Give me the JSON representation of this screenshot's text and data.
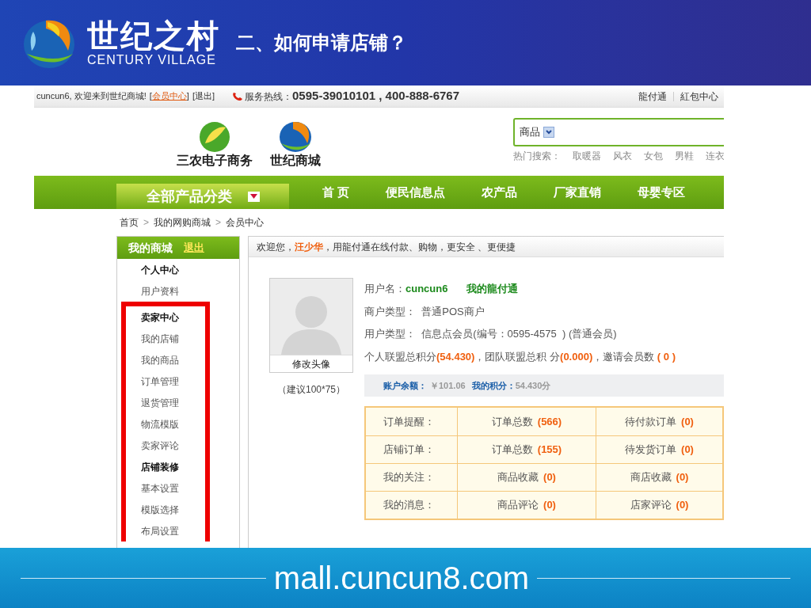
{
  "slide": {
    "brand_cn": "世纪之村",
    "brand_en": "CENTURY VILLAGE",
    "title": "二、如何申请店铺？",
    "footer_url": "mall.cuncun8.com"
  },
  "top_bar": {
    "greeting": "cuncun6, 欢迎来到世纪商城!",
    "member_link_brackets": [
      "[",
      "]"
    ],
    "member_link": "会员中心",
    "logout_link": "[退出]",
    "hotline_label": "服务热线：",
    "hotline_numbers": "0595-39010101 , 400-888-6767",
    "links": [
      "龍付通",
      "紅包中心"
    ]
  },
  "logos": [
    {
      "label": "三农电子商务"
    },
    {
      "label": "世纪商城"
    }
  ],
  "search": {
    "category": "商品",
    "hot_label": "热门搜索：",
    "hot_terms": [
      "取暖器",
      "风衣",
      "女包",
      "男鞋",
      "连衣"
    ]
  },
  "nav": {
    "category_button": "全部产品分类",
    "items": [
      "首 页",
      "便民信息点",
      "农产品",
      "厂家直销",
      "母婴专区"
    ]
  },
  "breadcrumb": {
    "separator": ">",
    "items": [
      "首页",
      "我的网购商城",
      "会员中心"
    ]
  },
  "sidebar": {
    "title": "我的商城",
    "logout": "退出",
    "sections": [
      {
        "heading": "个人中心",
        "highlighted": false,
        "items": [
          "用户资料"
        ]
      },
      {
        "heading": "卖家中心",
        "highlighted": true,
        "items": [
          "我的店铺",
          "我的商品",
          "订单管理",
          "退货管理",
          "物流模版",
          "卖家评论"
        ]
      },
      {
        "heading": "店铺装修",
        "highlighted": true,
        "items": [
          "基本设置",
          "模版选择",
          "布局设置"
        ]
      }
    ]
  },
  "welcome": {
    "prefix": "欢迎您，",
    "name": "汪少华",
    "suffix": "，用龍付通在线付款、购物，更安全 、更便捷"
  },
  "profile": {
    "change_avatar": "修改头像",
    "avatar_hint": "（建议100*75）",
    "username_label": "用户名：",
    "username": "cuncun6",
    "wallet_link": "我的龍付通",
    "merchant_type": "商户类型：  普通POS商户",
    "user_type": "用户类型：  信息点会员(编号：0595-4575  ) (普通会员)",
    "points": [
      {
        "label": "个人联盟总积分",
        "value": "(54.430)"
      },
      {
        "label": "，团队联盟总积 分",
        "value": "(0.000)"
      },
      {
        "label": "，邀请会员数",
        "value": " ( 0 )"
      }
    ]
  },
  "balance": {
    "balance_label": "账户余额：",
    "balance_value": "￥101.06",
    "points_label": "我的积分：",
    "points_value": "54.430分"
  },
  "summary_table": {
    "rows": [
      {
        "label": "订单提醒：",
        "cells": [
          {
            "text": "订单总数",
            "count": "(566)"
          },
          {
            "text": "待付款订单",
            "count": "(0)"
          }
        ]
      },
      {
        "label": "店铺订单：",
        "cells": [
          {
            "text": "订单总数",
            "count": "(155)"
          },
          {
            "text": "待发货订单",
            "count": "(0)"
          }
        ]
      },
      {
        "label": "我的关注：",
        "cells": [
          {
            "text": "商品收藏",
            "count": "(0)"
          },
          {
            "text": "商店收藏",
            "count": "(0)"
          }
        ]
      },
      {
        "label": "我的消息：",
        "cells": [
          {
            "text": "商品评论",
            "count": "(0)"
          },
          {
            "text": "店家评论",
            "count": "(0)"
          }
        ]
      }
    ]
  }
}
